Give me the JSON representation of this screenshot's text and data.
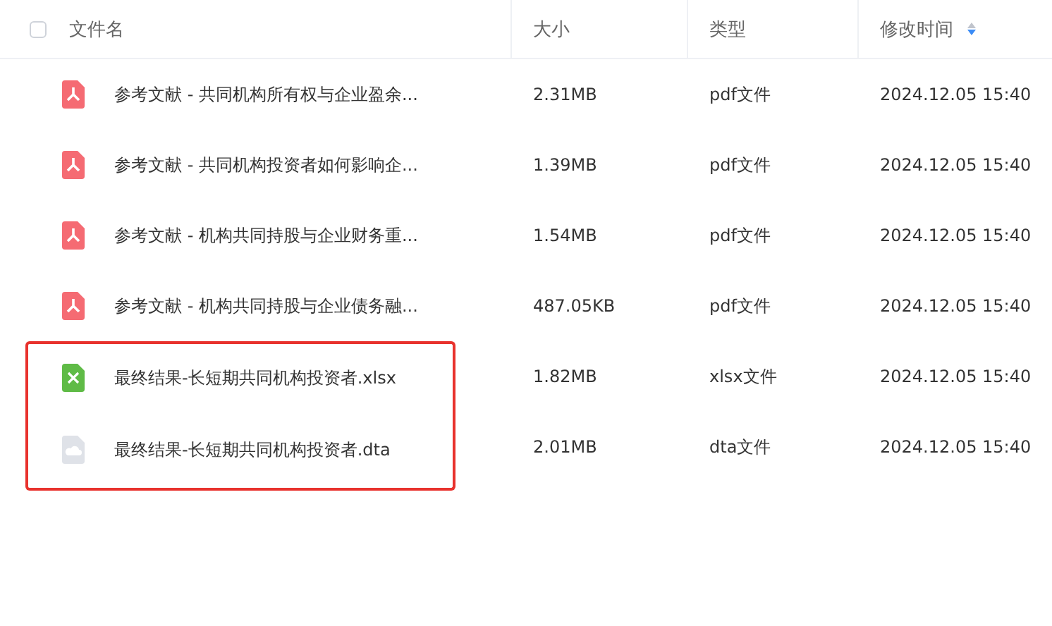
{
  "table": {
    "select_all": {
      "checked": false
    },
    "columns": [
      {
        "label": "文件名"
      },
      {
        "label": "大小"
      },
      {
        "label": "类型"
      },
      {
        "label": "修改时间",
        "sorted_descending": true
      }
    ],
    "rows": [
      {
        "kind": "pdf",
        "name": "参考文献 - 共同机构所有权与企业盈余...",
        "size": "2.31MB",
        "type": "pdf文件",
        "modified": "2024.12.05 15:40",
        "highlighted": false
      },
      {
        "kind": "pdf",
        "name": "参考文献 - 共同机构投资者如何影响企...",
        "size": "1.39MB",
        "type": "pdf文件",
        "modified": "2024.12.05 15:40",
        "highlighted": false
      },
      {
        "kind": "pdf",
        "name": "参考文献 - 机构共同持股与企业财务重...",
        "size": "1.54MB",
        "type": "pdf文件",
        "modified": "2024.12.05 15:40",
        "highlighted": false
      },
      {
        "kind": "pdf",
        "name": "参考文献 - 机构共同持股与企业债务融...",
        "size": "487.05KB",
        "type": "pdf文件",
        "modified": "2024.12.05 15:40",
        "highlighted": false
      },
      {
        "kind": "xlsx",
        "name": "最终结果-长短期共同机构投资者.xlsx",
        "size": "1.82MB",
        "type": "xlsx文件",
        "modified": "2024.12.05 15:40",
        "highlighted": true
      },
      {
        "kind": "dta",
        "name": "最终结果-长短期共同机构投资者.dta",
        "size": "2.01MB",
        "type": "dta文件",
        "modified": "2024.12.05 15:40",
        "highlighted": true
      }
    ]
  }
}
